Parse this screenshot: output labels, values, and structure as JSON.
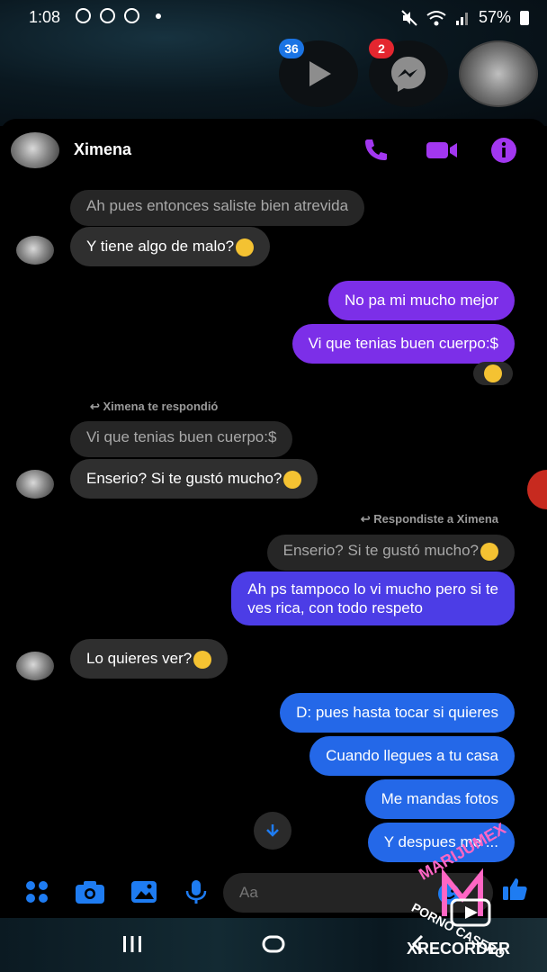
{
  "status_bar": {
    "time": "1:08",
    "battery": "57%"
  },
  "chat_heads": [
    {
      "badge": "36",
      "icon": "play-icon"
    },
    {
      "badge": "2",
      "icon": "messenger-icon"
    },
    {
      "badge": "",
      "icon": "avatar"
    }
  ],
  "header": {
    "contact_name": "Ximena"
  },
  "messages": {
    "m1_quote": "Ah pues entonces saliste bien atrevida",
    "m2": "Y tiene algo de malo?",
    "m3": "No pa mi mucho mejor",
    "m4": "Vi que tenias buen cuerpo:$",
    "reply_note_1": "Ximena te respondió",
    "m5_quote": "Vi que tenias buen cuerpo:$",
    "m6": "Enserio? Si te gustó mucho?",
    "reply_note_2": "Respondiste a Ximena",
    "m7_quote": "Enserio? Si te gustó mucho?",
    "m8_line1": "Ah ps tampoco lo vi mucho pero si te",
    "m8_line2": "ves rica, con todo respeto",
    "m9": "Lo quieres ver?",
    "m10": "D: pues hasta tocar si quieres",
    "m11": "Cuando llegues a tu casa",
    "m12": "Me mandas fotos",
    "m13": "Y despues me ",
    "m13_tail": "..."
  },
  "composer": {
    "placeholder": "Aa"
  },
  "watermark": {
    "arc_top": "MARIJUMEX",
    "arc_bottom": "PORNO CASERO",
    "recorder": "XRECORDER"
  },
  "colors": {
    "accent": "#a237f0",
    "out_purple": "#7c2fe8",
    "out_violet": "#4c3de6",
    "out_blue": "#2468e8",
    "incoming": "#2f2f2f",
    "composer_icons": "#1e7cf2"
  }
}
